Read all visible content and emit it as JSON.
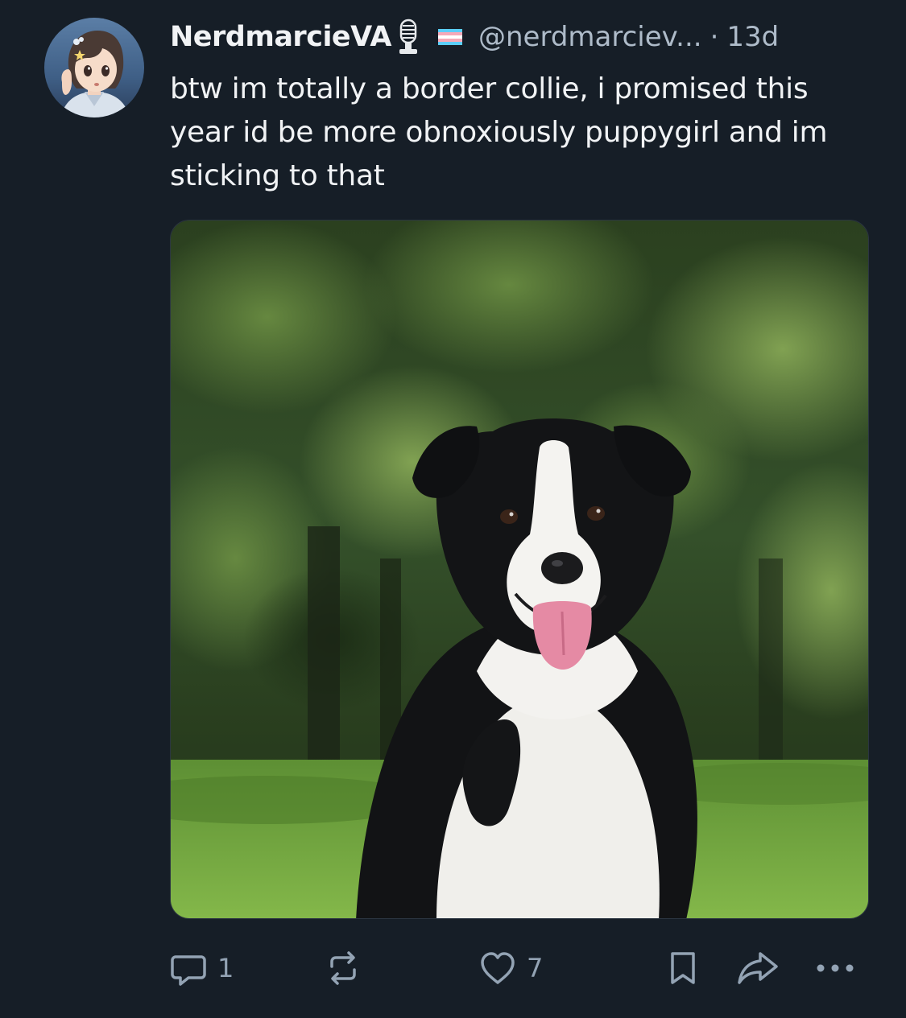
{
  "post": {
    "display_name": "NerdmarcieVA",
    "handle": "@nerdmarciev...",
    "separator": "·",
    "time": "13d",
    "text": "btw im totally a border collie, i promised this year id be more obnoxiously puppygirl and im sticking to that",
    "avatar_icon": "anime-character-avatar",
    "badges": [
      "microphone-icon",
      "trans-flag-icon"
    ],
    "media": {
      "icon": "border-collie-photo",
      "colors": {
        "foliage": "#2f4a22",
        "grass": "#6fa63a",
        "fur_black": "#111214",
        "fur_white": "#f2f1ee",
        "tongue": "#e58aa4"
      }
    }
  },
  "actions": {
    "reply": {
      "icon": "reply-icon",
      "count": "1"
    },
    "repost": {
      "icon": "repost-icon",
      "count": ""
    },
    "like": {
      "icon": "heart-icon",
      "count": "7"
    },
    "bookmark": {
      "icon": "bookmark-icon"
    },
    "share": {
      "icon": "share-icon"
    },
    "more": {
      "icon": "more-icon"
    }
  },
  "colors": {
    "background": "#161e27",
    "text": "#f1f3f5",
    "muted": "#aebbc9",
    "action": "#93a3b4"
  }
}
